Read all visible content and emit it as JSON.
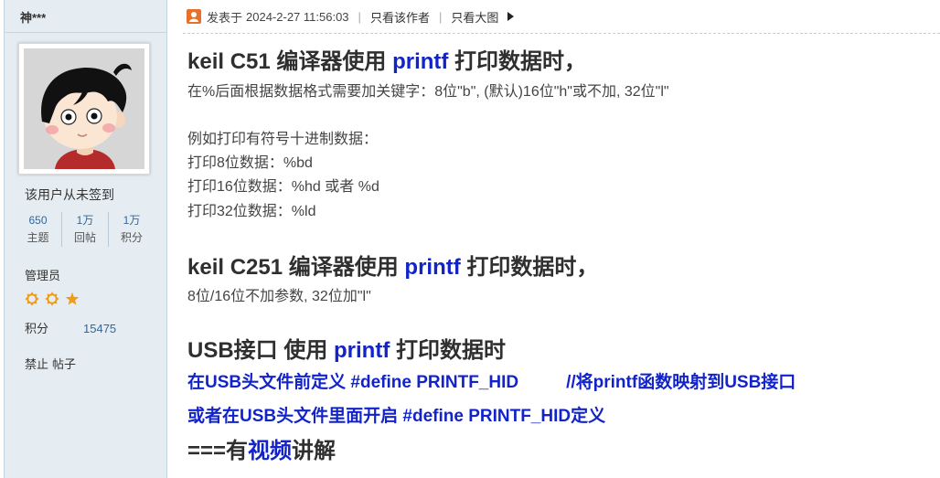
{
  "colors": {
    "sidebar_bg": "#e5edf2",
    "border": "#c2d5e3",
    "link": "#336699",
    "accent_blue": "#1224c9",
    "icon_orange": "#f19c16",
    "author_icon_orange": "#e8712a"
  },
  "sidebar": {
    "username": "神***",
    "signin_status": "该用户从未签到",
    "stats": [
      {
        "value": "650",
        "label": "主题"
      },
      {
        "value": "1万",
        "label": "回帖"
      },
      {
        "value": "1万",
        "label": "积分"
      }
    ],
    "group_title": "管理员",
    "rank_icons": [
      "sun-icon",
      "sun-icon",
      "star-icon"
    ],
    "points": {
      "label": "积分",
      "value": "15475"
    },
    "admin_links": [
      "禁止",
      "帖子"
    ]
  },
  "post_header": {
    "author_icon": "user-icon",
    "posted_label": "发表于",
    "posted_time": "2024-2-27 11:56:03",
    "separator": "|",
    "only_author": "只看该作者",
    "only_large_images": "只看大图",
    "menu_icon": "caret-right-icon"
  },
  "post": {
    "heading_c51": [
      "keil C51 编译器使用 ",
      "printf",
      " 打印数据时，"
    ],
    "c51_note": "在%后面根据数据格式需要加关键字：8位\"b\", (默认)16位\"h\"或不加, 32位\"l\"",
    "example_intro": "例如打印有符号十进制数据：",
    "examples": [
      "打印8位数据：%bd",
      "打印16位数据：%hd 或者 %d",
      "打印32位数据：%ld"
    ],
    "heading_c251": [
      "keil C251 编译器使用 ",
      "printf",
      " 打印数据时，"
    ],
    "c251_note": "8位/16位不加参数, 32位加\"l\"",
    "heading_usb": [
      "USB接口 使用 ",
      "printf",
      " 打印数据时"
    ],
    "usb_define_line": [
      "在USB头文件前定义 #define PRINTF_HID",
      "//将printf函数映射到USB接口"
    ],
    "usb_enable_line": "或者在USB头文件里面开启 #define PRINTF_HID定义",
    "video_note": [
      "===有",
      "视频",
      "讲解"
    ]
  }
}
